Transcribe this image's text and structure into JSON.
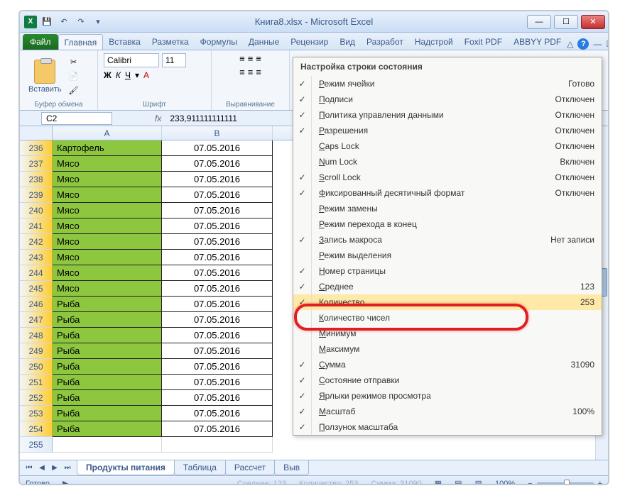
{
  "title": "Книга8.xlsx - Microsoft Excel",
  "ribbon": {
    "file": "Файл",
    "tabs": [
      "Главная",
      "Вставка",
      "Разметка",
      "Формулы",
      "Данные",
      "Рецензир",
      "Вид",
      "Разработ",
      "Надстрой",
      "Foxit PDF",
      "ABBYY PDF"
    ],
    "active_tab": 0
  },
  "clipboard": {
    "paste": "Вставить",
    "group": "Буфер обмена"
  },
  "font": {
    "name": "Calibri",
    "size": "11",
    "group": "Шрифт"
  },
  "align": {
    "group": "Выравнивание"
  },
  "name_box": "C2",
  "fx": "fx",
  "formula": "233,911111111111",
  "columns": [
    "A",
    "B"
  ],
  "rows": [
    {
      "n": 236,
      "a": "Картофель",
      "b": "07.05.2016"
    },
    {
      "n": 237,
      "a": "Мясо",
      "b": "07.05.2016"
    },
    {
      "n": 238,
      "a": "Мясо",
      "b": "07.05.2016"
    },
    {
      "n": 239,
      "a": "Мясо",
      "b": "07.05.2016"
    },
    {
      "n": 240,
      "a": "Мясо",
      "b": "07.05.2016"
    },
    {
      "n": 241,
      "a": "Мясо",
      "b": "07.05.2016"
    },
    {
      "n": 242,
      "a": "Мясо",
      "b": "07.05.2016"
    },
    {
      "n": 243,
      "a": "Мясо",
      "b": "07.05.2016"
    },
    {
      "n": 244,
      "a": "Мясо",
      "b": "07.05.2016"
    },
    {
      "n": 245,
      "a": "Мясо",
      "b": "07.05.2016"
    },
    {
      "n": 246,
      "a": "Рыба",
      "b": "07.05.2016"
    },
    {
      "n": 247,
      "a": "Рыба",
      "b": "07.05.2016"
    },
    {
      "n": 248,
      "a": "Рыба",
      "b": "07.05.2016"
    },
    {
      "n": 249,
      "a": "Рыба",
      "b": "07.05.2016"
    },
    {
      "n": 250,
      "a": "Рыба",
      "b": "07.05.2016"
    },
    {
      "n": 251,
      "a": "Рыба",
      "b": "07.05.2016"
    },
    {
      "n": 252,
      "a": "Рыба",
      "b": "07.05.2016"
    },
    {
      "n": 253,
      "a": "Рыба",
      "b": "07.05.2016"
    },
    {
      "n": 254,
      "a": "Рыба",
      "b": "07.05.2016"
    },
    {
      "n": 255,
      "a": "",
      "b": ""
    }
  ],
  "sheet_tabs": [
    "Продукты питания",
    "Таблица",
    "Рассчет",
    "Выв"
  ],
  "active_sheet": 0,
  "status": {
    "ready": "Готово",
    "average_label": "Среднее: 123",
    "count_label": "Количество: 253",
    "sum_label": "Сумма: 31090",
    "zoom": "100%"
  },
  "context_menu": {
    "title": "Настройка строки состояния",
    "items": [
      {
        "checked": true,
        "label": "Режим ячейки",
        "value": "Готово"
      },
      {
        "checked": true,
        "label": "Подписи",
        "value": "Отключен"
      },
      {
        "checked": true,
        "label": "Политика управления данными",
        "value": "Отключен"
      },
      {
        "checked": true,
        "label": "Разрешения",
        "value": "Отключен"
      },
      {
        "checked": false,
        "label": "Caps Lock",
        "value": "Отключен"
      },
      {
        "checked": false,
        "label": "Num Lock",
        "value": "Включен"
      },
      {
        "checked": true,
        "label": "Scroll Lock",
        "value": "Отключен"
      },
      {
        "checked": true,
        "label": "Фиксированный десятичный формат",
        "value": "Отключен"
      },
      {
        "checked": false,
        "label": "Режим замены",
        "value": ""
      },
      {
        "checked": false,
        "label": "Режим перехода в конец",
        "value": ""
      },
      {
        "checked": true,
        "label": "Запись макроса",
        "value": "Нет записи"
      },
      {
        "checked": false,
        "label": "Режим выделения",
        "value": ""
      },
      {
        "checked": true,
        "label": "Номер страницы",
        "value": ""
      },
      {
        "checked": true,
        "label": "Среднее",
        "value": "123"
      },
      {
        "checked": true,
        "label": "Количество",
        "value": "253",
        "highlighted": true
      },
      {
        "checked": false,
        "label": "Количество чисел",
        "value": ""
      },
      {
        "checked": false,
        "label": "Минимум",
        "value": ""
      },
      {
        "checked": false,
        "label": "Максимум",
        "value": ""
      },
      {
        "checked": true,
        "label": "Сумма",
        "value": "31090"
      },
      {
        "checked": true,
        "label": "Состояние отправки",
        "value": ""
      },
      {
        "checked": true,
        "label": "Ярлыки режимов просмотра",
        "value": ""
      },
      {
        "checked": true,
        "label": "Масштаб",
        "value": "100%"
      },
      {
        "checked": true,
        "label": "Ползунок масштаба",
        "value": ""
      }
    ]
  }
}
